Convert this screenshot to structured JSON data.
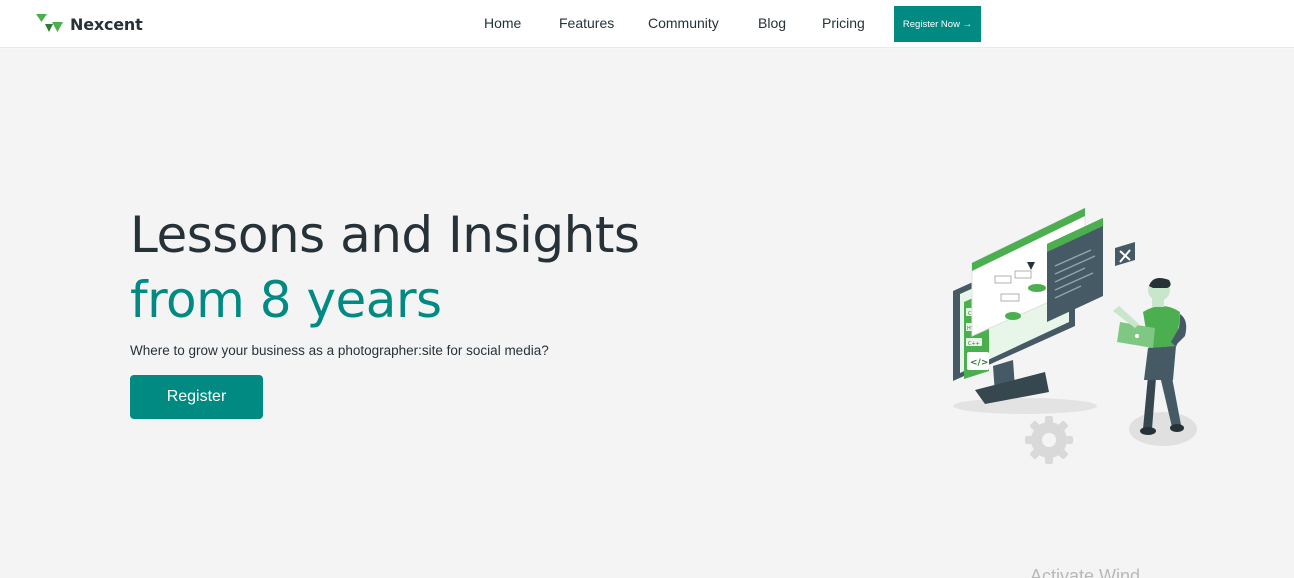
{
  "brand": {
    "name": "Nexcent",
    "logo_icon": "nexcent-triangles-icon"
  },
  "nav": {
    "links": [
      "Home",
      "Features",
      "Community",
      "Blog",
      "Pricing"
    ],
    "cta_label": "Register Now →"
  },
  "hero": {
    "headline_line1": "Lessons and Insights",
    "headline_line2": "from 8 years",
    "subtext": "Where to grow your business as a photographer:site for social media?",
    "button_label": "Register",
    "illustration": "developer-with-laptop-and-monitor-illustration"
  },
  "illustration_labels": {
    "tag1": "CSS",
    "tag2": "HTML",
    "tag3": "C++",
    "code_icon": "</>"
  },
  "watermark": {
    "text": "Activate Wind"
  },
  "colors": {
    "brand": "#4CAF4F",
    "accent": "#008A82",
    "text_dark": "#263238",
    "hero_bg": "#F4F4F5",
    "nav_bg": "#FFFFFF"
  }
}
